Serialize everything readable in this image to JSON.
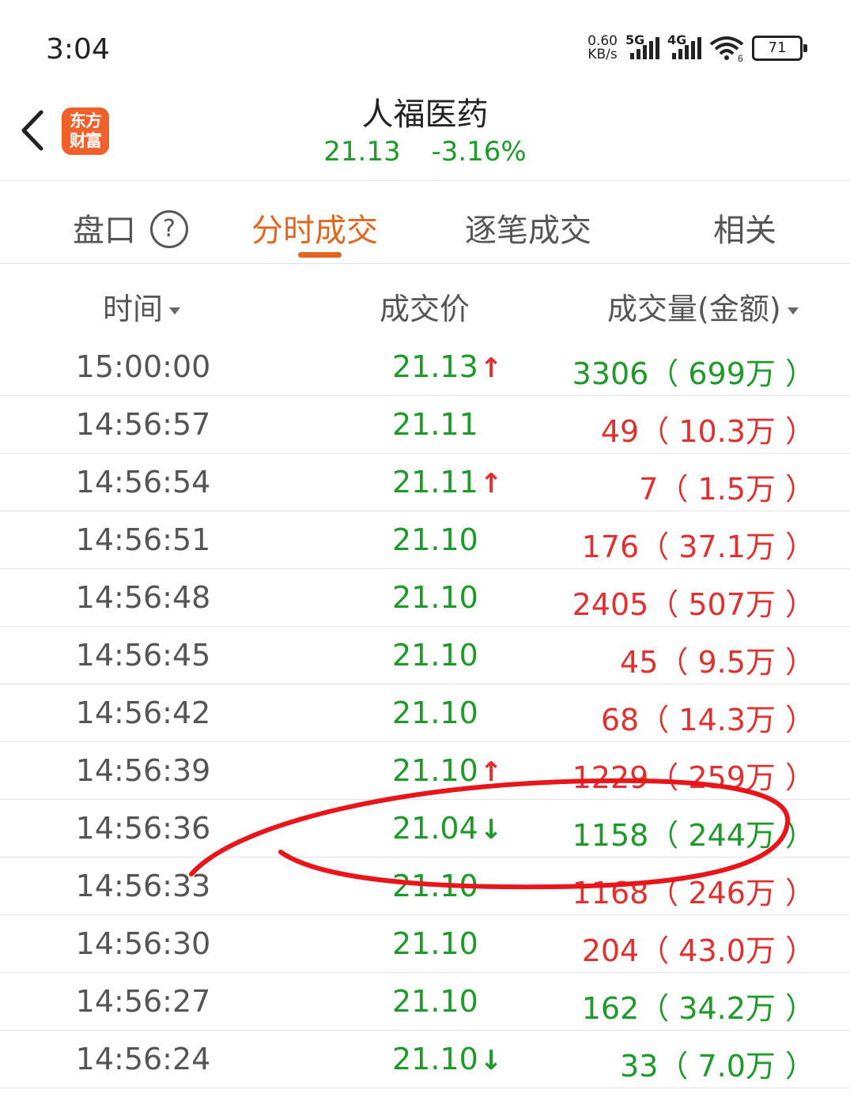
{
  "status_bar": {
    "time": "3:04",
    "net_speed_value": "0.60",
    "net_speed_unit": "KB/s",
    "signal1_label": "5G",
    "signal2_label": "4G",
    "wifi_badge": "6",
    "battery": "71"
  },
  "header": {
    "app_logo_line1": "东方",
    "app_logo_line2": "财富",
    "stock_name": "人福医药",
    "price": "21.13",
    "change_pct": "-3.16%"
  },
  "tabs": [
    {
      "label": "盘口",
      "help": "?"
    },
    {
      "label": "分时成交",
      "active": true
    },
    {
      "label": "逐笔成交"
    },
    {
      "label": "相关"
    }
  ],
  "columns": {
    "time": "时间",
    "price": "成交价",
    "volume": "成交量(金额)"
  },
  "rows": [
    {
      "time": "15:00:00",
      "price": "21.13",
      "arrow": "↑",
      "vol": "3306（ 699万 ）",
      "vol_color": "green"
    },
    {
      "time": "14:56:57",
      "price": "21.11",
      "arrow": "",
      "vol": "49（ 10.3万 ）",
      "vol_color": "red"
    },
    {
      "time": "14:56:54",
      "price": "21.11",
      "arrow": "↑",
      "vol": "7（ 1.5万 ）",
      "vol_color": "red"
    },
    {
      "time": "14:56:51",
      "price": "21.10",
      "arrow": "",
      "vol": "176（ 37.1万 ）",
      "vol_color": "red"
    },
    {
      "time": "14:56:48",
      "price": "21.10",
      "arrow": "",
      "vol": "2405（ 507万 ）",
      "vol_color": "red"
    },
    {
      "time": "14:56:45",
      "price": "21.10",
      "arrow": "",
      "vol": "45（ 9.5万 ）",
      "vol_color": "red"
    },
    {
      "time": "14:56:42",
      "price": "21.10",
      "arrow": "",
      "vol": "68（ 14.3万 ）",
      "vol_color": "red"
    },
    {
      "time": "14:56:39",
      "price": "21.10",
      "arrow": "↑",
      "vol": "1229（ 259万 ）",
      "vol_color": "red"
    },
    {
      "time": "14:56:36",
      "price": "21.04",
      "arrow": "↓",
      "vol": "1158（ 244万 ）",
      "vol_color": "green"
    },
    {
      "time": "14:56:33",
      "price": "21.10",
      "arrow": "",
      "vol": "1168（ 246万 ）",
      "vol_color": "red"
    },
    {
      "time": "14:56:30",
      "price": "21.10",
      "arrow": "",
      "vol": "204（ 43.0万 ）",
      "vol_color": "red"
    },
    {
      "time": "14:56:27",
      "price": "21.10",
      "arrow": "",
      "vol": "162（ 34.2万 ）",
      "vol_color": "green"
    },
    {
      "time": "14:56:24",
      "price": "21.10",
      "arrow": "↓",
      "vol": "33（ 7.0万 ）",
      "vol_color": "green"
    }
  ],
  "colors": {
    "accent": "#e2661d",
    "down_green": "#1d9a2a",
    "up_red": "#e0302f",
    "annotation": "#e8161b"
  }
}
